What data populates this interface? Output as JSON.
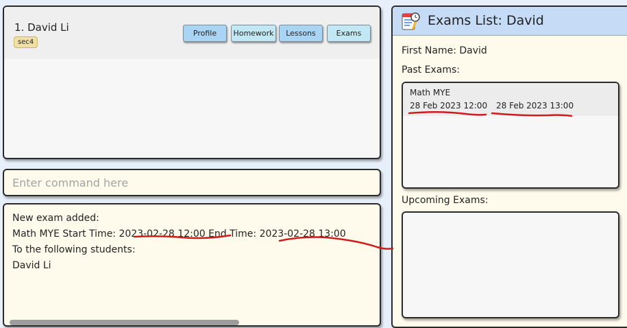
{
  "student_list": {
    "student": {
      "index_name": "1.  David Li",
      "tag": "sec4"
    },
    "buttons": {
      "profile": "Profile",
      "homework": "Homework",
      "lessons": "Lessons",
      "exams": "Exams"
    }
  },
  "command": {
    "placeholder": "Enter command here",
    "value": ""
  },
  "result": {
    "text": "New exam added:\nMath MYE Start Time: 2023-02-28 12:00 End Time: 2023-02-28 13:00\nTo the following students:\nDavid Li"
  },
  "exams_panel": {
    "title": "Exams List: David",
    "icon": "exam-list-icon",
    "first_name": "First Name: David",
    "past_label": "Past Exams:",
    "upcoming_label": "Upcoming Exams:",
    "past_exams": [
      {
        "name": "Math MYE",
        "start": "28 Feb 2023 12:00",
        "end": "28 Feb 2023 13:00"
      }
    ],
    "upcoming_exams": []
  },
  "colors": {
    "annotation": "#d11b1b",
    "header": "#c6dcf6",
    "panel_bg": "#fffbec"
  }
}
